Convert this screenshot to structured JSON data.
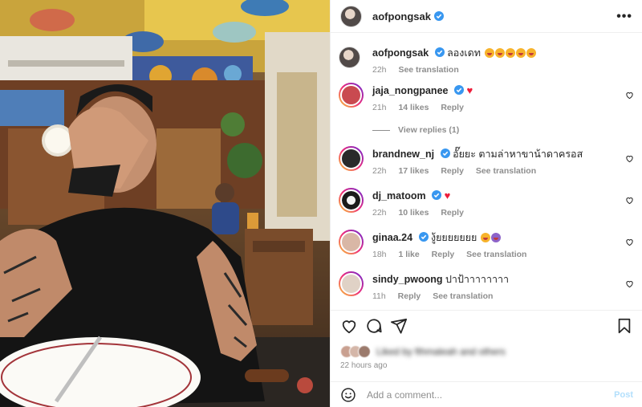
{
  "post": {
    "author": "aofpongsak",
    "more_label": "•••"
  },
  "caption": {
    "username": "aofpongsak",
    "text": "ลองเดท",
    "time": "22h",
    "see_translation": "See translation"
  },
  "comments": [
    {
      "username": "jaja_nongpanee",
      "text": "",
      "has_red_heart": true,
      "time": "21h",
      "likes": "14 likes",
      "reply": "Reply",
      "translation": ""
    },
    {
      "username": "brandnew_nj",
      "text": "อั๊ยยะ ตามล่าหาขาน้าดาครอส",
      "has_red_heart": false,
      "time": "22h",
      "likes": "17 likes",
      "reply": "Reply",
      "translation": "See translation"
    },
    {
      "username": "dj_matoom",
      "text": "",
      "has_red_heart": true,
      "time": "22h",
      "likes": "10 likes",
      "reply": "Reply",
      "translation": ""
    },
    {
      "username": "ginaa.24",
      "text": "งู้ยยยยยยย",
      "has_red_heart": false,
      "time": "18h",
      "likes": "1 like",
      "reply": "Reply",
      "translation": "See translation"
    },
    {
      "username": "sindy_pwoong",
      "text": "ปาป้าาาาาาาา",
      "has_red_heart": false,
      "time": "11h",
      "likes": "",
      "reply": "Reply",
      "translation": "See translation"
    }
  ],
  "view_replies": "View replies (1)",
  "likes_blurred": "Liked by fthmaleah and others",
  "posted_ago": "22 hours ago",
  "add_comment": {
    "placeholder": "Add a comment...",
    "post_label": "Post"
  },
  "colors": {
    "verified": "#3897f0",
    "red_heart": "#ed1d3a",
    "post_disabled": "#b2dffc"
  }
}
